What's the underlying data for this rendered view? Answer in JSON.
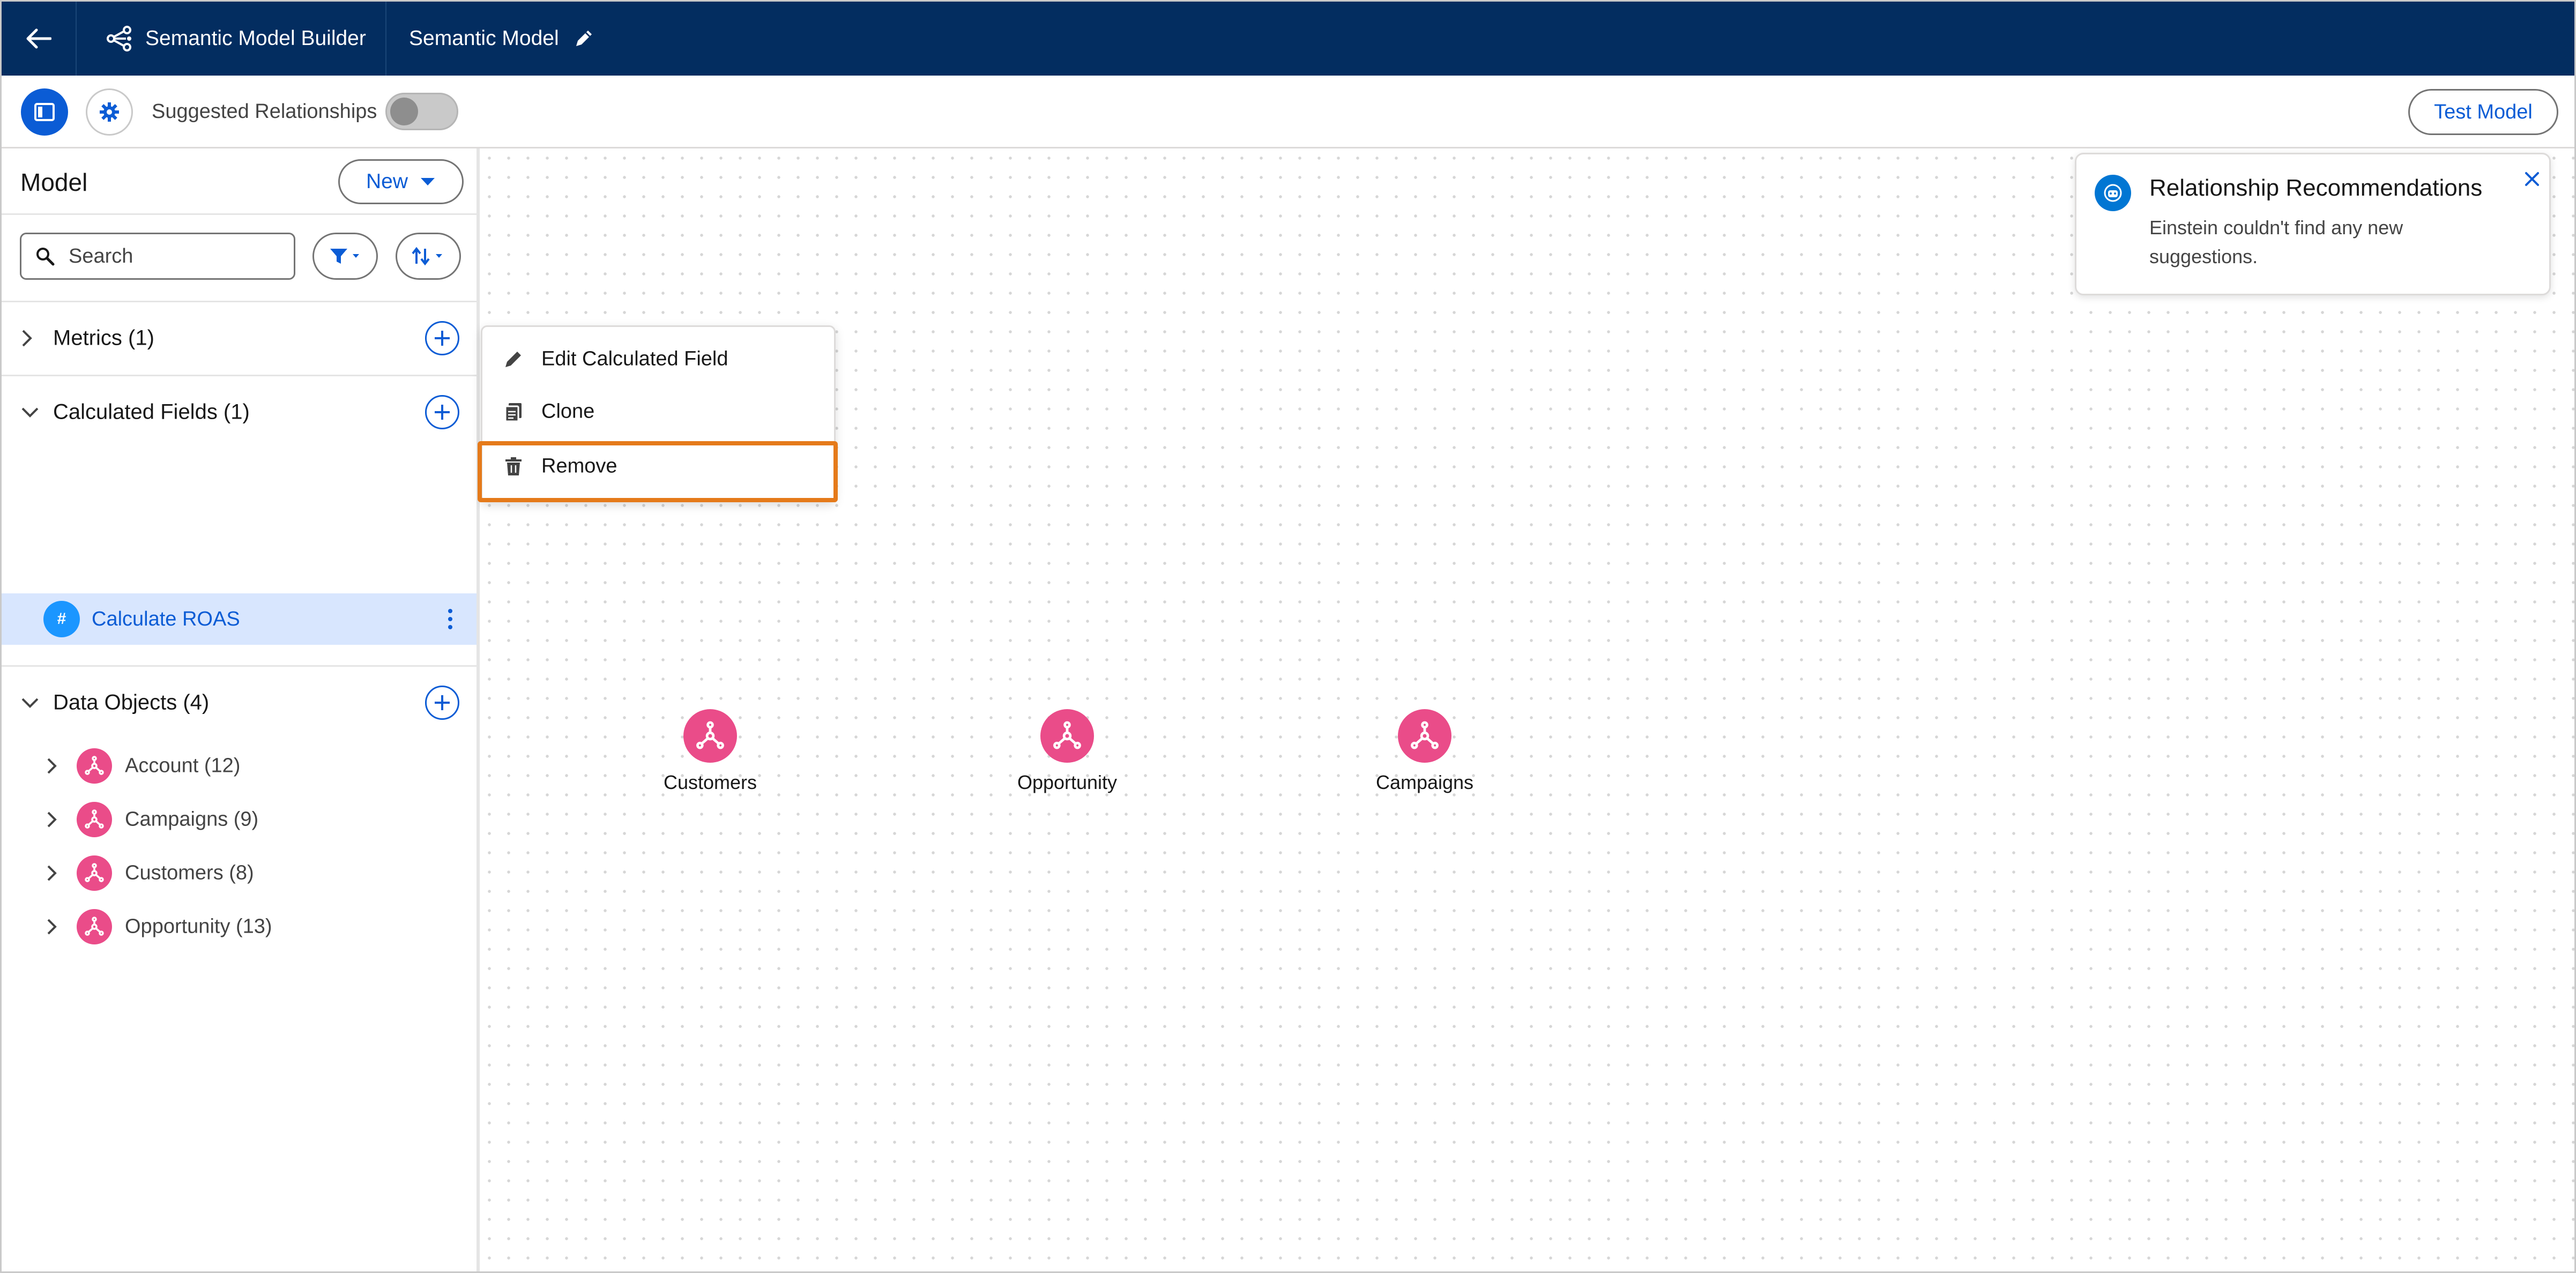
{
  "header": {
    "app_name": "Semantic Model Builder",
    "model_name": "Semantic Model"
  },
  "toolbar": {
    "suggested_relationships_label": "Suggested Relationships",
    "suggested_relationships_on": false,
    "test_model_label": "Test Model"
  },
  "sidebar": {
    "title": "Model",
    "new_label": "New",
    "search_placeholder": "Search",
    "sections": [
      {
        "label": "Metrics (1)",
        "expanded": false
      },
      {
        "label": "Calculated Fields (1)",
        "expanded": true
      },
      {
        "label": "Data Objects (4)",
        "expanded": true
      }
    ],
    "calculated_fields": [
      {
        "label": "Calculate ROAS",
        "icon": "#"
      }
    ],
    "data_objects": [
      {
        "label": "Account (12)"
      },
      {
        "label": "Campaigns (9)"
      },
      {
        "label": "Customers (8)"
      },
      {
        "label": "Opportunity (13)"
      }
    ]
  },
  "context_menu": {
    "items": [
      {
        "label": "Edit Calculated Field",
        "icon": "pencil-icon"
      },
      {
        "label": "Clone",
        "icon": "clone-icon"
      },
      {
        "label": "Remove",
        "icon": "trash-icon",
        "highlighted": true
      }
    ]
  },
  "canvas": {
    "nodes": [
      {
        "label": "Customers"
      },
      {
        "label": "Opportunity"
      },
      {
        "label": "Campaigns"
      }
    ]
  },
  "recommendations": {
    "title": "Relationship Recommendations",
    "body": "Einstein couldn't find any new suggestions."
  },
  "colors": {
    "nav_bg": "#032d60",
    "brand_blue": "#0b5cd5",
    "object_pink": "#ea4c89",
    "highlight_orange": "#e57a1a",
    "selected_row": "#d8e6fe"
  }
}
